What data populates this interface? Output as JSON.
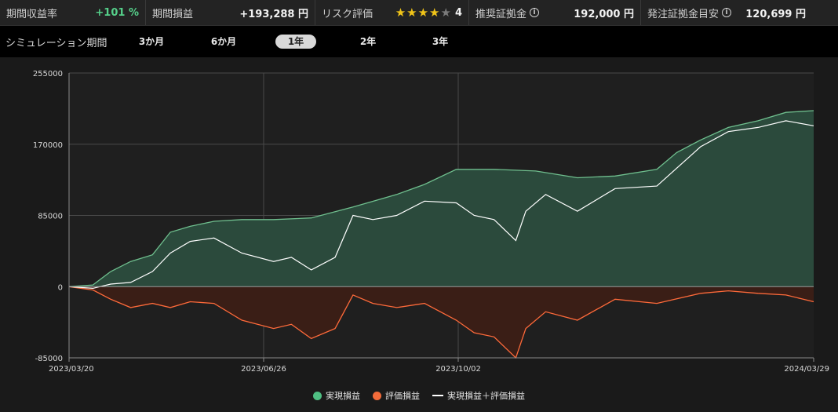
{
  "stats": {
    "period_return": {
      "label": "期間収益率",
      "value": "+101 %"
    },
    "period_profit": {
      "label": "期間損益",
      "value": "+193,288 円"
    },
    "risk": {
      "label": "リスク評価",
      "value": "4",
      "stars_on": 4,
      "stars_total": 5
    },
    "recommended_margin": {
      "label": "推奨証拠金",
      "value": "192,000 円"
    },
    "order_margin": {
      "label": "発注証拠金目安",
      "value": "120,699 円"
    }
  },
  "period": {
    "label": "シミュレーション期間",
    "tabs": [
      "3か月",
      "6か月",
      "1年",
      "2年",
      "3年"
    ],
    "active": 2
  },
  "colors": {
    "realized_fill": "#2b4a3c",
    "realized_line": "#6fbf8e",
    "unrealized_fill": "#3a1e16",
    "unrealized_line": "#ff6a3a",
    "total_line": "#ffffff",
    "legend_realized": "#4fbf83",
    "legend_unrealized": "#f26b3a"
  },
  "chart_data": {
    "type": "area",
    "y_ticks": [
      "255000",
      "170000",
      "85000",
      "0",
      "-85000"
    ],
    "ylim": [
      -85000,
      255000
    ],
    "x_ticks": [
      "2023/03/20",
      "2023/06/26",
      "2023/10/02",
      "2024/03/29"
    ],
    "grid": true,
    "legend_position": "bottom",
    "series": [
      {
        "name": "実現損益",
        "type": "area",
        "x": [
          "2023-03-20",
          "2023-04-01",
          "2023-04-10",
          "2023-04-20",
          "2023-05-01",
          "2023-05-10",
          "2023-05-20",
          "2023-06-01",
          "2023-06-15",
          "2023-07-01",
          "2023-07-20",
          "2023-08-10",
          "2023-09-01",
          "2023-09-15",
          "2023-10-01",
          "2023-10-20",
          "2023-11-10",
          "2023-12-01",
          "2023-12-20",
          "2024-01-10",
          "2024-01-20",
          "2024-02-01",
          "2024-02-15",
          "2024-03-01",
          "2024-03-15",
          "2024-03-29"
        ],
        "values": [
          0,
          2000,
          18000,
          30000,
          38000,
          65000,
          72000,
          78000,
          80000,
          80000,
          82000,
          95000,
          110000,
          122000,
          140000,
          140000,
          138000,
          130000,
          132000,
          140000,
          160000,
          175000,
          190000,
          198000,
          208000,
          210000
        ]
      },
      {
        "name": "評価損益",
        "type": "area",
        "x": [
          "2023-03-20",
          "2023-04-01",
          "2023-04-10",
          "2023-04-20",
          "2023-05-01",
          "2023-05-10",
          "2023-05-20",
          "2023-06-01",
          "2023-06-15",
          "2023-07-01",
          "2023-07-10",
          "2023-07-20",
          "2023-08-01",
          "2023-08-10",
          "2023-08-20",
          "2023-09-01",
          "2023-09-15",
          "2023-10-01",
          "2023-10-10",
          "2023-10-20",
          "2023-10-31",
          "2023-11-05",
          "2023-11-15",
          "2023-12-01",
          "2023-12-20",
          "2024-01-10",
          "2024-02-01",
          "2024-02-15",
          "2024-03-01",
          "2024-03-15",
          "2024-03-29"
        ],
        "values": [
          0,
          -4000,
          -15000,
          -25000,
          -20000,
          -25000,
          -18000,
          -20000,
          -40000,
          -50000,
          -45000,
          -62000,
          -50000,
          -10000,
          -20000,
          -25000,
          -20000,
          -40000,
          -55000,
          -60000,
          -85000,
          -50000,
          -30000,
          -40000,
          -15000,
          -20000,
          -8000,
          -5000,
          -8000,
          -10000,
          -18000
        ]
      },
      {
        "name": "実現損益＋評価損益",
        "type": "line",
        "x": [
          "2023-03-20",
          "2023-04-01",
          "2023-04-10",
          "2023-04-20",
          "2023-05-01",
          "2023-05-10",
          "2023-05-20",
          "2023-06-01",
          "2023-06-15",
          "2023-07-01",
          "2023-07-10",
          "2023-07-20",
          "2023-08-01",
          "2023-08-10",
          "2023-08-20",
          "2023-09-01",
          "2023-09-15",
          "2023-10-01",
          "2023-10-10",
          "2023-10-20",
          "2023-10-31",
          "2023-11-05",
          "2023-11-15",
          "2023-12-01",
          "2023-12-20",
          "2024-01-10",
          "2024-02-01",
          "2024-02-15",
          "2024-03-01",
          "2024-03-15",
          "2024-03-29"
        ],
        "values": [
          0,
          -2000,
          3000,
          5000,
          18000,
          40000,
          54000,
          58000,
          40000,
          30000,
          35000,
          20000,
          35000,
          85000,
          80000,
          85000,
          102000,
          100000,
          85000,
          80000,
          55000,
          90000,
          110000,
          90000,
          117000,
          120000,
          167000,
          185000,
          190000,
          198000,
          192000
        ]
      }
    ]
  }
}
